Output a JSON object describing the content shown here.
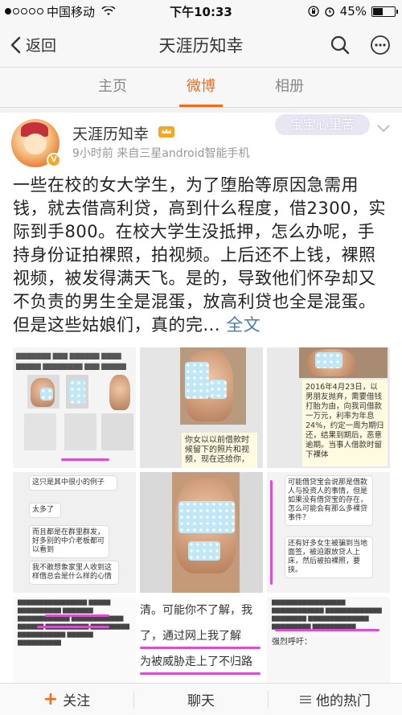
{
  "status_bar": {
    "carrier": "中国移动",
    "time": "下午10:33",
    "battery": "45%",
    "battery_level": 0.45
  },
  "nav": {
    "back_label": "返回",
    "title": "天涯历知幸"
  },
  "tabs": [
    {
      "label": "主页",
      "active": false
    },
    {
      "label": "微博",
      "active": true
    },
    {
      "label": "相册",
      "active": false
    }
  ],
  "post": {
    "username": "天涯历知幸",
    "meta": "9小时前  来自三星android智能手机",
    "watermark": "宝宝心里苦",
    "text": "一些在校的女大学生，为了堕胎等原因急需用钱，就去借高利贷，高到什么程度，借2300，实际到手800。在校大学生没抵押，怎么办呢，手持身份证拍裸照，拍视频。上后还不上钱，裸照视频，被发得满天飞。是的，导致他们怀孕却又不负责的男生全是混蛋，放高利贷也全是混蛋。但是这些姑娘们，真的完...",
    "full_link": "全文"
  },
  "images": {
    "img2_caption": "你女以以前借款时候留下的照片和视频，现在还给你，",
    "img3_caption": "2016年4月23日，以男朋友抛弃，需要借钱打胎为由，向我司借款一万元，利率为年息24%，约定一周为期归还，结果到期后，恶意逾期。当事人借款时留下裸体",
    "img4_lines": [
      "这只是其中很小的例子",
      "太多了",
      "而且都是在群里群发，好多别的中介老板都可以看到",
      "我不敢想象家里人收到这样借总会是什么样的心情"
    ],
    "img6_lines": [
      "可能借贷宝会说那是借款人与投资人的事情，但是如果没有借贷宝的存在，怎么可能会有那么多裸贷事件？",
      "还有好多女生被骗到当地面签，被迫跟放贷人上床，然后被拍裸照，要挟。"
    ],
    "img8_lines": [
      "清。可能你不了解，我",
      "了，通过网上我了解",
      "为被威胁走上了不归路"
    ],
    "img9_label": "强烈呼吁："
  },
  "bottom_bar": {
    "follow": "关注",
    "chat": "聊天",
    "hot": "他的热门"
  }
}
